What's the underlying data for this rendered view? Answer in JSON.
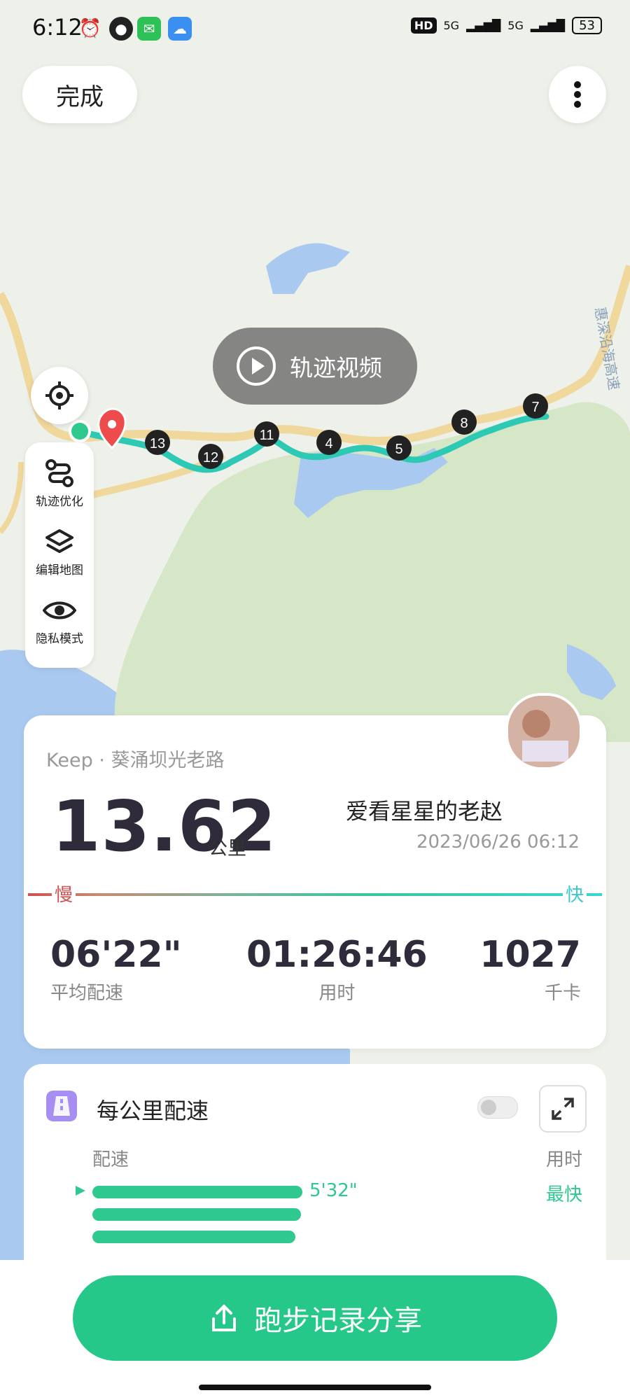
{
  "status_bar": {
    "time": "6:12",
    "battery": "53",
    "network_1": "5G",
    "network_2": "5G",
    "hd_badge": "HD",
    "icons": [
      "alarm-icon",
      "notification-icon",
      "wechat-icon",
      "cloud-app-icon"
    ]
  },
  "header": {
    "done_label": "完成",
    "more_icon": "more-vertical-icon"
  },
  "map": {
    "video_label": "轨迹视频",
    "highway_label": "惠深沿海高速",
    "km_markers": [
      "13",
      "12",
      "11",
      "4",
      "5",
      "8",
      "7"
    ],
    "tools": [
      {
        "label": "轨迹优化",
        "icon": "route-optimize-icon"
      },
      {
        "label": "编辑地图",
        "icon": "layers-icon"
      },
      {
        "label": "隐私模式",
        "icon": "eye-icon"
      }
    ]
  },
  "summary": {
    "route_name": "Keep · 葵涌坝光老路",
    "distance": "13.62",
    "unit": "公里",
    "username": "爱看星星的老赵",
    "datetime": "2023/06/26 06:12",
    "slow_label": "慢",
    "fast_label": "快",
    "stats": [
      {
        "value": "06'22\"",
        "label": "平均配速"
      },
      {
        "value": "01:26:46",
        "label": "用时"
      },
      {
        "value": "1027",
        "label": "千卡"
      }
    ]
  },
  "pace_card": {
    "title": "每公里配速",
    "col_pace": "配速",
    "col_time": "用时",
    "first_pace": "5'32\"",
    "fastest_label": "最快",
    "bar_levels": [
      1.0,
      0.99,
      0.97
    ]
  },
  "footer": {
    "share_label": "跑步记录分享"
  },
  "colors": {
    "accent": "#26c88a",
    "route_cyan": "#3ad6d0",
    "slow_red": "#d05050",
    "map_green": "#d6e7c8",
    "water_blue": "#a9c9f0"
  }
}
